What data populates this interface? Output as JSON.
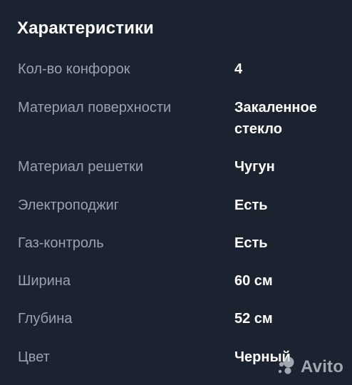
{
  "title": "Характеристики",
  "specs": [
    {
      "label": "Кол-во конфорок",
      "value": "4"
    },
    {
      "label": "Материал поверхности",
      "value": "Закаленное стекло"
    },
    {
      "label": "Материал решетки",
      "value": "Чугун"
    },
    {
      "label": "Электроподжиг",
      "value": "Есть"
    },
    {
      "label": "Газ-контроль",
      "value": "Есть"
    },
    {
      "label": "Ширина",
      "value": "60 см"
    },
    {
      "label": "Глубина",
      "value": "52 см"
    },
    {
      "label": "Цвет",
      "value": "Черный"
    }
  ],
  "watermark": {
    "text": "Avito",
    "icon": "avito-logo-icon",
    "color": "#cfd3d8"
  },
  "colors": {
    "background": "#1b2230",
    "label": "#9aa2ad",
    "value": "#ffffff"
  }
}
